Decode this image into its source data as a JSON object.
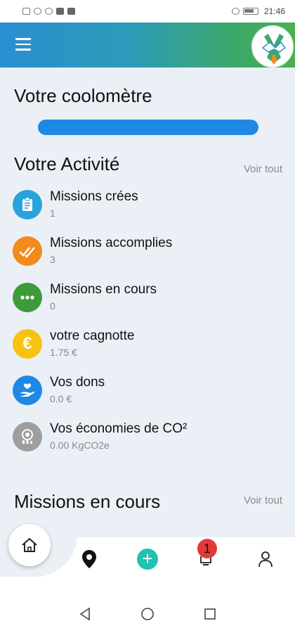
{
  "status_bar": {
    "time": "21:46"
  },
  "header": {
    "menu_icon": "hamburger-menu-icon",
    "logo_icon": "handshake-logo-icon"
  },
  "coolometer": {
    "title": "Votre coolomètre",
    "level": 1.0,
    "color": "#1e88e5"
  },
  "activity": {
    "title": "Votre Activité",
    "see_all": "Voir tout",
    "items": [
      {
        "label": "Missions crées",
        "value": "1",
        "icon": "clipboard-icon",
        "color": "#29a3dc"
      },
      {
        "label": "Missions accomplies",
        "value": "3",
        "icon": "double-check-icon",
        "color": "#f28a1c"
      },
      {
        "label": "Missions en cours",
        "value": "0",
        "icon": "dots-icon",
        "color": "#3e9b39"
      },
      {
        "label": "votre cagnotte",
        "value": "1.75 €",
        "icon": "euro-icon",
        "color": "#f7c211"
      },
      {
        "label": "Vos dons",
        "value": "0.0 €",
        "icon": "heart-hand-icon",
        "color": "#1e88e5"
      },
      {
        "label": "Vos économies de CO²",
        "value": "0.00 KgCO2e",
        "icon": "co2-icon",
        "color": "#9e9e9e"
      }
    ]
  },
  "missions": {
    "title": "Missions en cours",
    "see_all": "Voir tout"
  },
  "bottom_nav": {
    "items": [
      "home-icon",
      "map-pin-icon",
      "add-icon",
      "notification-icon",
      "profile-icon"
    ],
    "notification_count": "1",
    "add_label": "+"
  },
  "colors": {
    "header_gradient_start": "#2a8fd0",
    "header_gradient_end": "#4caf50",
    "background": "#eaf0f6",
    "add_button": "#21c2b0",
    "badge": "#e53935"
  }
}
